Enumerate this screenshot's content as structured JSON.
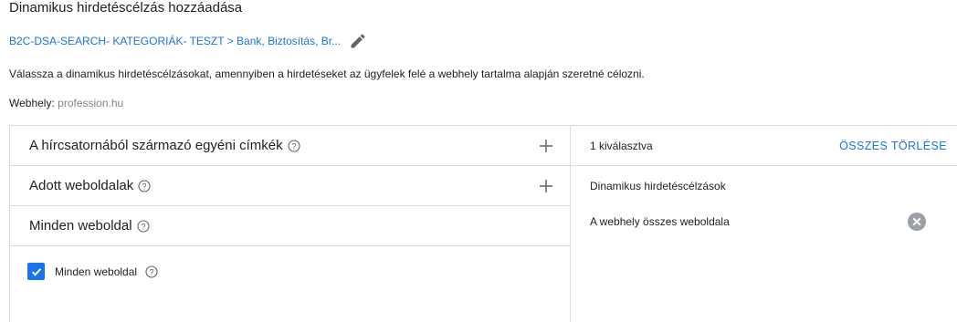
{
  "page": {
    "title": "Dinamikus hirdetéscélzás hozzáadása",
    "breadcrumb": "B2C-DSA-SEARCH- KATEGORIÁK- TESZT > Bank, Biztosítás, Br...",
    "description": "Válassza a dinamikus hirdetéscélzásokat, amennyiben a hirdetéseket az ügyfelek felé a webhely tartalma alapján szeretné célozni.",
    "website_label": "Webhely:",
    "website_value": "profession.hu"
  },
  "sections": [
    {
      "label": "A hírcsatornából származó egyéni címkék",
      "icon": "plus-icon"
    },
    {
      "label": "Adott weboldalak",
      "icon": "plus-icon"
    },
    {
      "label": "Minden weboldal"
    }
  ],
  "option": {
    "label": "Minden weboldal",
    "checked": true
  },
  "selection": {
    "count_text": "1 kiválasztva",
    "clear_all": "ÖSSZES TÖRLÉSE",
    "group_title": "Dinamikus hirdetéscélzások",
    "items": [
      "A webhely összes weboldala"
    ]
  },
  "colors": {
    "accent": "#1a73e8",
    "border": "#dadce0",
    "muted": "#80868b"
  }
}
